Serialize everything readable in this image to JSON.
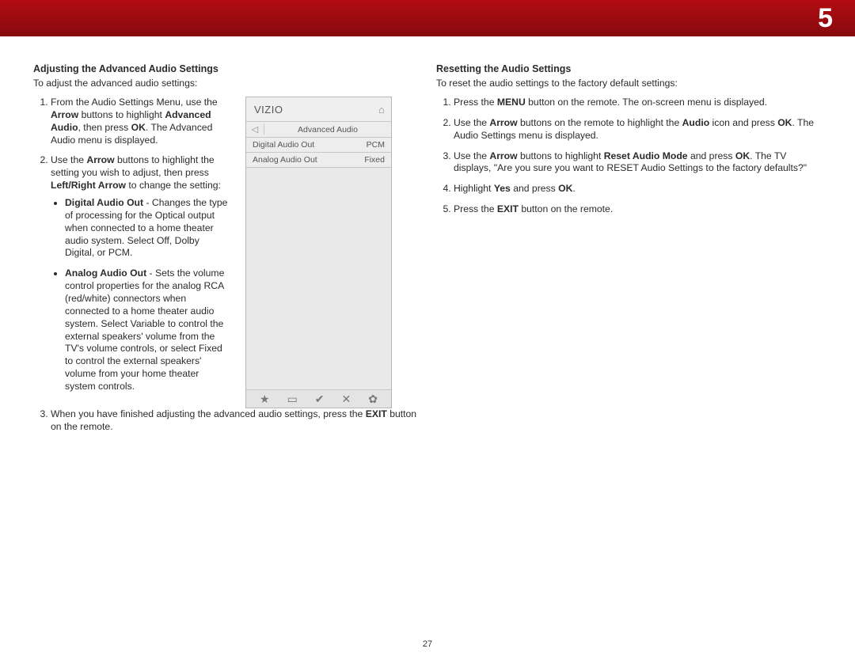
{
  "chapter_number": "5",
  "page_number": "27",
  "left": {
    "heading": "Adjusting the Advanced Audio Settings",
    "intro": "To adjust the advanced audio settings:",
    "step1_a": "From the Audio Settings Menu, use the ",
    "step1_b": "Arrow",
    "step1_c": " buttons to highlight ",
    "step1_d": "Advanced Audio",
    "step1_e": ", then press ",
    "step1_f": "OK",
    "step1_g": ". The Advanced Audio menu is displayed.",
    "step2_a": "Use the ",
    "step2_b": "Arrow",
    "step2_c": " buttons to highlight the setting you wish to adjust, then press ",
    "step2_d": "Left/Right Arrow",
    "step2_e": " to change the setting:",
    "bullet1_t": "Digital Audio Out",
    "bullet1_r": " - Changes the type of processing for the Optical output when connected to a home theater audio system. Select Off, Dolby Digital, or PCM.",
    "bullet2_t": "Analog Audio Out",
    "bullet2_r": " - Sets the volume control properties for the analog RCA (red/white) connectors when connected to a home theater audio system. Select Variable to control the external speakers' volume from the TV's volume controls, or select Fixed to control the external speakers' volume from your home theater system controls.",
    "step3_a": "When you have finished adjusting the advanced audio settings, press the ",
    "step3_b": "EXIT",
    "step3_c": " button on the remote."
  },
  "menu": {
    "logo": "VIZIO",
    "title": "Advanced Audio",
    "rows": [
      {
        "label": "Digital Audio Out",
        "value": "PCM"
      },
      {
        "label": "Analog Audio Out",
        "value": "Fixed"
      }
    ]
  },
  "right": {
    "heading": "Resetting the Audio Settings",
    "intro": "To reset the audio settings to the factory default settings:",
    "step1_a": "Press the ",
    "step1_b": "MENU",
    "step1_c": " button on the remote. The on-screen menu is displayed.",
    "step2_a": "Use the ",
    "step2_b": "Arrow",
    "step2_c": " buttons on the remote to highlight the ",
    "step2_d": "Audio",
    "step2_e": " icon and press ",
    "step2_f": "OK",
    "step2_g": ". The Audio Settings menu is displayed.",
    "step3_a": "Use the ",
    "step3_b": "Arrow",
    "step3_c": " buttons to highlight ",
    "step3_d": "Reset Audio Mode",
    "step3_e": " and press ",
    "step3_f": "OK",
    "step3_g": ". The TV displays, \"Are you sure you want to RESET Audio Settings to the factory defaults?\"",
    "step4_a": "Highlight ",
    "step4_b": "Yes",
    "step4_c": " and press ",
    "step4_d": "OK",
    "step4_e": ".",
    "step5_a": "Press the ",
    "step5_b": "EXIT",
    "step5_c": " button on the remote."
  }
}
